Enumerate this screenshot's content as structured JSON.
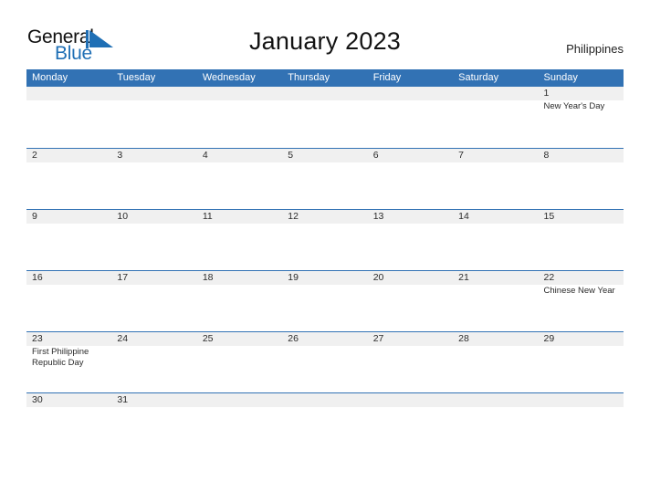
{
  "brand": {
    "word_one": "General",
    "word_two": "Blue",
    "triangle_icon": "triangle-icon",
    "color_dark": "#111111",
    "color_blue": "#1f6fb5"
  },
  "header": {
    "title": "January 2023",
    "country": "Philippines"
  },
  "theme": {
    "header_blue": "#3272b4",
    "band_gray": "#f0f0f0",
    "text": "#2b2b2b"
  },
  "calendar": {
    "weekdays": [
      "Monday",
      "Tuesday",
      "Wednesday",
      "Thursday",
      "Friday",
      "Saturday",
      "Sunday"
    ],
    "weeks": [
      [
        {
          "day": "",
          "event": ""
        },
        {
          "day": "",
          "event": ""
        },
        {
          "day": "",
          "event": ""
        },
        {
          "day": "",
          "event": ""
        },
        {
          "day": "",
          "event": ""
        },
        {
          "day": "",
          "event": ""
        },
        {
          "day": "1",
          "event": "New Year's Day"
        }
      ],
      [
        {
          "day": "2",
          "event": ""
        },
        {
          "day": "3",
          "event": ""
        },
        {
          "day": "4",
          "event": ""
        },
        {
          "day": "5",
          "event": ""
        },
        {
          "day": "6",
          "event": ""
        },
        {
          "day": "7",
          "event": ""
        },
        {
          "day": "8",
          "event": ""
        }
      ],
      [
        {
          "day": "9",
          "event": ""
        },
        {
          "day": "10",
          "event": ""
        },
        {
          "day": "11",
          "event": ""
        },
        {
          "day": "12",
          "event": ""
        },
        {
          "day": "13",
          "event": ""
        },
        {
          "day": "14",
          "event": ""
        },
        {
          "day": "15",
          "event": ""
        }
      ],
      [
        {
          "day": "16",
          "event": ""
        },
        {
          "day": "17",
          "event": ""
        },
        {
          "day": "18",
          "event": ""
        },
        {
          "day": "19",
          "event": ""
        },
        {
          "day": "20",
          "event": ""
        },
        {
          "day": "21",
          "event": ""
        },
        {
          "day": "22",
          "event": "Chinese New Year"
        }
      ],
      [
        {
          "day": "23",
          "event": "First Philippine Republic Day"
        },
        {
          "day": "24",
          "event": ""
        },
        {
          "day": "25",
          "event": ""
        },
        {
          "day": "26",
          "event": ""
        },
        {
          "day": "27",
          "event": ""
        },
        {
          "day": "28",
          "event": ""
        },
        {
          "day": "29",
          "event": ""
        }
      ],
      [
        {
          "day": "30",
          "event": ""
        },
        {
          "day": "31",
          "event": ""
        },
        {
          "day": "",
          "event": ""
        },
        {
          "day": "",
          "event": ""
        },
        {
          "day": "",
          "event": ""
        },
        {
          "day": "",
          "event": ""
        },
        {
          "day": "",
          "event": ""
        }
      ]
    ]
  }
}
